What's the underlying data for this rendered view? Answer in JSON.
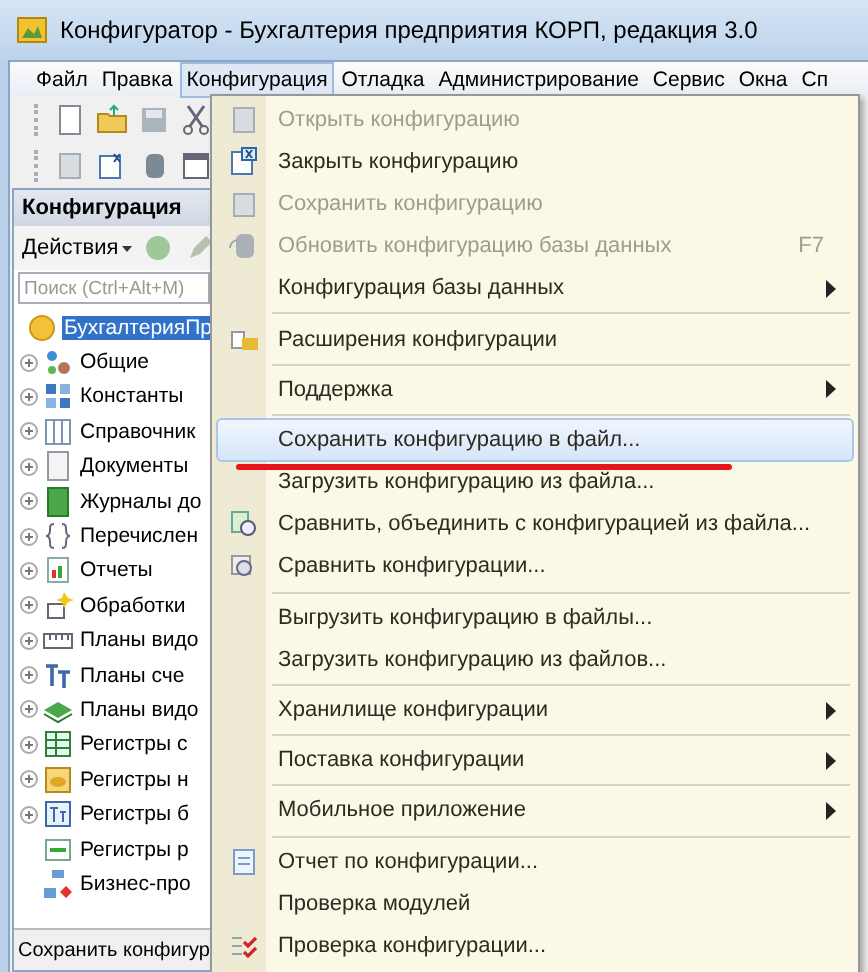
{
  "window": {
    "title": "Конфигуратор - Бухгалтерия предприятия КОРП, редакция 3.0"
  },
  "menubar": [
    {
      "label": "Файл",
      "selected": false
    },
    {
      "label": "Правка",
      "selected": false
    },
    {
      "label": "Конфигурация",
      "selected": true
    },
    {
      "label": "Отладка",
      "selected": false
    },
    {
      "label": "Администрирование",
      "selected": false
    },
    {
      "label": "Сервис",
      "selected": false
    },
    {
      "label": "Окна",
      "selected": false
    },
    {
      "label": "Сп",
      "selected": false
    }
  ],
  "panel": {
    "title": "Конфигурация",
    "actions": "Действия",
    "search": {
      "placeholder": "Поиск (Ctrl+Alt+M)"
    }
  },
  "tree": [
    {
      "label": "БухгалтерияПр",
      "selected": true,
      "expandable": false
    },
    {
      "label": "Общие",
      "selected": false,
      "expandable": true
    },
    {
      "label": "Константы",
      "selected": false,
      "expandable": true
    },
    {
      "label": "Справочник",
      "selected": false,
      "expandable": true
    },
    {
      "label": "Документы",
      "selected": false,
      "expandable": true
    },
    {
      "label": "Журналы до",
      "selected": false,
      "expandable": true
    },
    {
      "label": "Перечислен",
      "selected": false,
      "expandable": true
    },
    {
      "label": "Отчеты",
      "selected": false,
      "expandable": true
    },
    {
      "label": "Обработки",
      "selected": false,
      "expandable": true
    },
    {
      "label": "Планы видо",
      "selected": false,
      "expandable": true
    },
    {
      "label": "Планы сче",
      "selected": false,
      "expandable": true
    },
    {
      "label": "Планы видо",
      "selected": false,
      "expandable": true
    },
    {
      "label": "Регистры с",
      "selected": false,
      "expandable": true
    },
    {
      "label": "Регистры н",
      "selected": false,
      "expandable": true
    },
    {
      "label": "Регистры б",
      "selected": false,
      "expandable": true
    },
    {
      "label": "Регистры р",
      "selected": false,
      "expandable": false
    },
    {
      "label": "Бизнес-про",
      "selected": false,
      "expandable": false
    }
  ],
  "status_bar": "Сохранить конфигур",
  "menu": [
    {
      "kind": "item",
      "label": "Открыть конфигурацию",
      "disabled": true,
      "selected": false
    },
    {
      "kind": "item",
      "label": "Закрыть конфигурацию",
      "disabled": false,
      "selected": false
    },
    {
      "kind": "item",
      "label": "Сохранить конфигурацию",
      "disabled": true,
      "selected": false
    },
    {
      "kind": "item",
      "label": "Обновить конфигурацию базы данных",
      "disabled": true,
      "selected": false,
      "shortcut": "F7"
    },
    {
      "kind": "item",
      "label": "Конфигурация базы данных",
      "disabled": false,
      "selected": false,
      "submenu": true
    },
    {
      "kind": "separator"
    },
    {
      "kind": "item",
      "label": "Расширения конфигурации",
      "disabled": false,
      "selected": false
    },
    {
      "kind": "separator"
    },
    {
      "kind": "item",
      "label": "Поддержка",
      "disabled": false,
      "selected": false,
      "submenu": true
    },
    {
      "kind": "separator"
    },
    {
      "kind": "item",
      "label": "Сохранить конфигурацию в файл...",
      "disabled": false,
      "selected": true,
      "underlined": true
    },
    {
      "kind": "item",
      "label": "Загрузить конфигурацию из файла...",
      "disabled": false,
      "selected": false
    },
    {
      "kind": "item",
      "label": "Сравнить, объединить с конфигурацией из файла...",
      "disabled": false,
      "selected": false
    },
    {
      "kind": "item",
      "label": "Сравнить конфигурации...",
      "disabled": false,
      "selected": false
    },
    {
      "kind": "separator"
    },
    {
      "kind": "item",
      "label": "Выгрузить конфигурацию в файлы...",
      "disabled": false,
      "selected": false
    },
    {
      "kind": "item",
      "label": "Загрузить конфигурацию из файлов...",
      "disabled": false,
      "selected": false
    },
    {
      "kind": "separator"
    },
    {
      "kind": "item",
      "label": "Хранилище конфигурации",
      "disabled": false,
      "selected": false,
      "submenu": true
    },
    {
      "kind": "separator"
    },
    {
      "kind": "item",
      "label": "Поставка конфигурации",
      "disabled": false,
      "selected": false,
      "submenu": true
    },
    {
      "kind": "separator"
    },
    {
      "kind": "item",
      "label": "Мобильное приложение",
      "disabled": false,
      "selected": false,
      "submenu": true
    },
    {
      "kind": "separator"
    },
    {
      "kind": "item",
      "label": "Отчет по конфигурации...",
      "disabled": false,
      "selected": false
    },
    {
      "kind": "item",
      "label": "Проверка модулей",
      "disabled": false,
      "selected": false
    },
    {
      "kind": "item",
      "label": "Проверка конфигурации...",
      "disabled": false,
      "selected": false
    }
  ]
}
